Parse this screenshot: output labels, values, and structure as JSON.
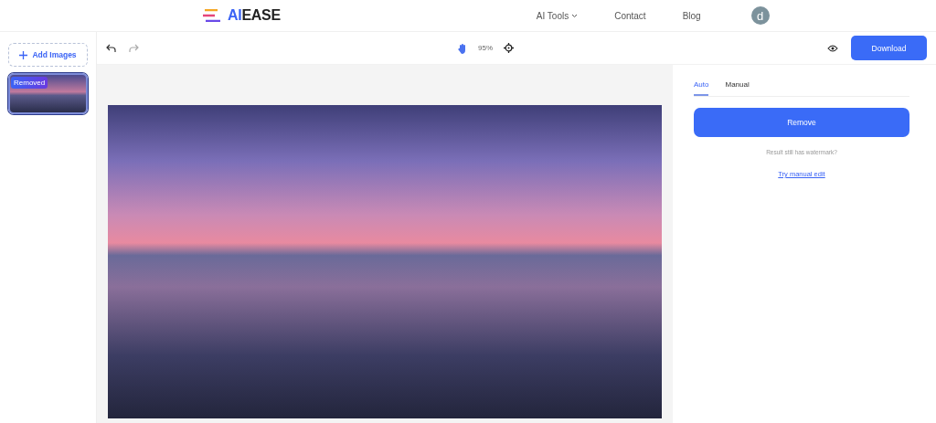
{
  "header": {
    "logo": {
      "accent": "AI",
      "rest": "EASE"
    },
    "nav": [
      {
        "label": "AI Tools",
        "kind": "dropdown"
      },
      {
        "label": "Contact",
        "kind": "link"
      },
      {
        "label": "Blog",
        "kind": "link"
      }
    ],
    "avatar": "d"
  },
  "sidebar": {
    "add_button": "Add Images",
    "thumbnails": [
      {
        "badge": "Removed",
        "selected": true
      }
    ]
  },
  "toolbar": {
    "zoom": "95%",
    "download": "Download"
  },
  "panel": {
    "tabs": [
      {
        "label": "Auto",
        "selected": true
      },
      {
        "label": "Manual",
        "selected": false
      }
    ],
    "remove_button": "Remove",
    "hint": "Result still has watermark?",
    "link": "Try manual edit"
  }
}
